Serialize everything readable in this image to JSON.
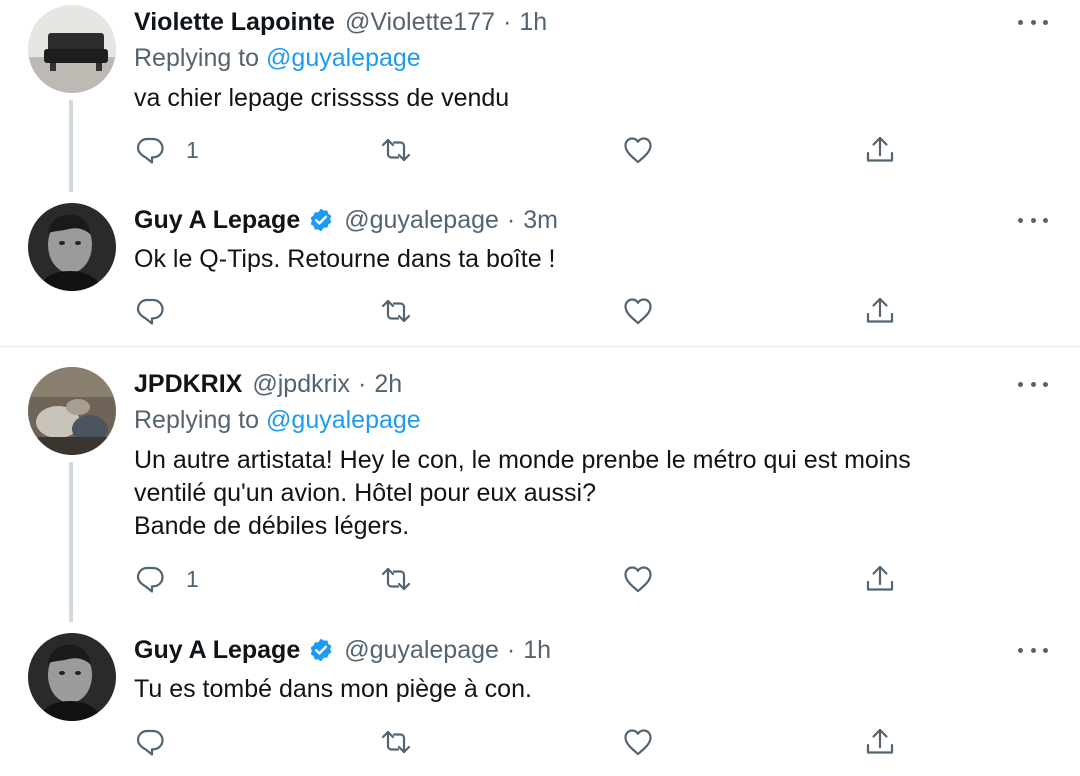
{
  "tweets": [
    {
      "name": "Violette Lapointe",
      "handle": "@Violette177",
      "time": "1h",
      "verified": false,
      "replying_label": "Replying to",
      "replying_mention": "@guyalepage",
      "text": "va chier lepage crisssss de vendu",
      "reply_count": "1"
    },
    {
      "name": "Guy A Lepage",
      "handle": "@guyalepage",
      "time": "3m",
      "verified": true,
      "text": "Ok le Q-Tips. Retourne dans ta boîte !",
      "reply_count": ""
    },
    {
      "name": "JPDKRIX",
      "handle": "@jpdkrix",
      "time": "2h",
      "verified": false,
      "replying_label": "Replying to",
      "replying_mention": "@guyalepage",
      "text": "Un autre artistata! Hey le con, le monde prenbe le métro qui est moins\nventilé qu'un avion. Hôtel pour eux aussi?\nBande de débiles légers.",
      "reply_count": "1"
    },
    {
      "name": "Guy A Lepage",
      "handle": "@guyalepage",
      "time": "1h",
      "verified": true,
      "text": "Tu es tombé dans mon piège à con.",
      "reply_count": ""
    }
  ],
  "separator": "·",
  "icons": {
    "reply": "reply-icon",
    "retweet": "retweet-icon",
    "like": "heart-icon",
    "share": "share-icon",
    "more": "more-icon",
    "verified": "verified-badge-icon"
  },
  "colors": {
    "link": "#1d9bf0",
    "secondary": "#536471",
    "verified": "#1d9bf0",
    "thread_line": "#cfd9de"
  }
}
